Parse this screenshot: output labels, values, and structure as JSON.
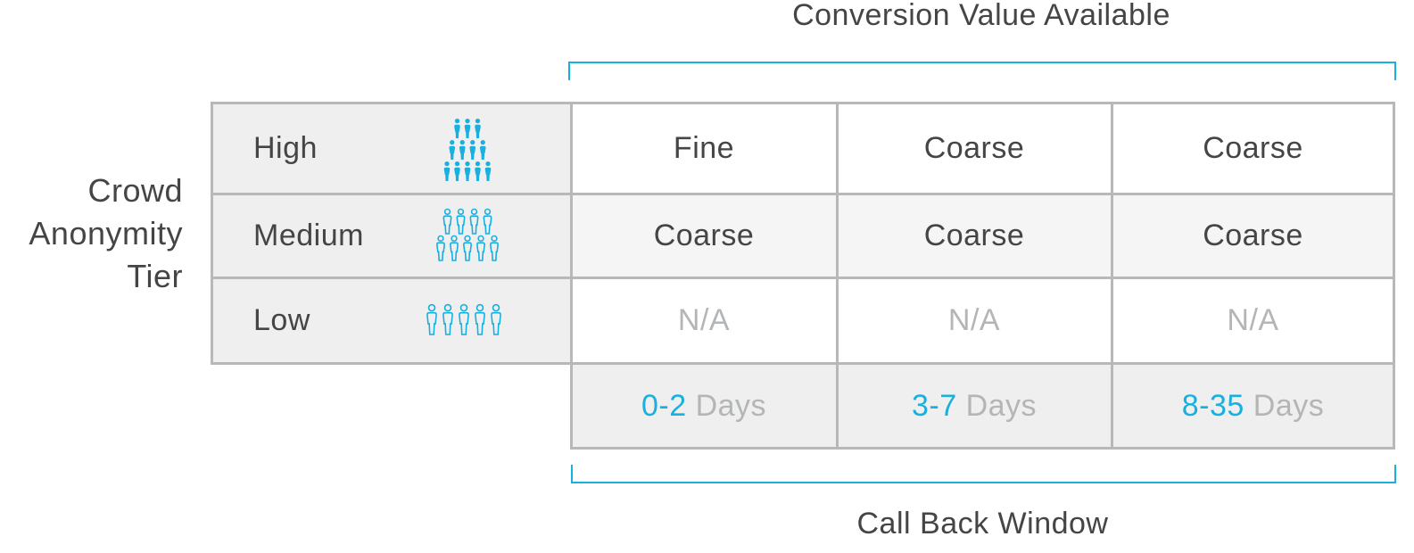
{
  "header": {
    "title": "Conversion Value Available"
  },
  "footer": {
    "title": "Call Back Window"
  },
  "side_label": {
    "lines": [
      "Crowd",
      "Anonymity",
      "Tier"
    ]
  },
  "colors": {
    "accent": "#17b0df",
    "text": "#454545",
    "muted": "#b3b5b7",
    "grid": "#b8b8b8",
    "panel": "#efefef",
    "alt_row": "#f5f5f5"
  },
  "tiers": [
    {
      "label": "High",
      "icon": "crowd-filled-icon",
      "people": 12,
      "rows_of_people": [
        3,
        4,
        5
      ]
    },
    {
      "label": "Medium",
      "icon": "crowd-outline-icon",
      "people": 9,
      "rows_of_people": [
        4,
        5
      ]
    },
    {
      "label": "Low",
      "icon": "people-outline-icon",
      "people": 5,
      "rows_of_people": [
        5
      ]
    }
  ],
  "windows": [
    {
      "range": "0-2",
      "unit": "Days"
    },
    {
      "range": "3-7",
      "unit": "Days"
    },
    {
      "range": "8-35",
      "unit": "Days"
    }
  ],
  "matrix": [
    [
      "Fine",
      "Coarse",
      "Coarse"
    ],
    [
      "Coarse",
      "Coarse",
      "Coarse"
    ],
    [
      "N/A",
      "N/A",
      "N/A"
    ]
  ]
}
